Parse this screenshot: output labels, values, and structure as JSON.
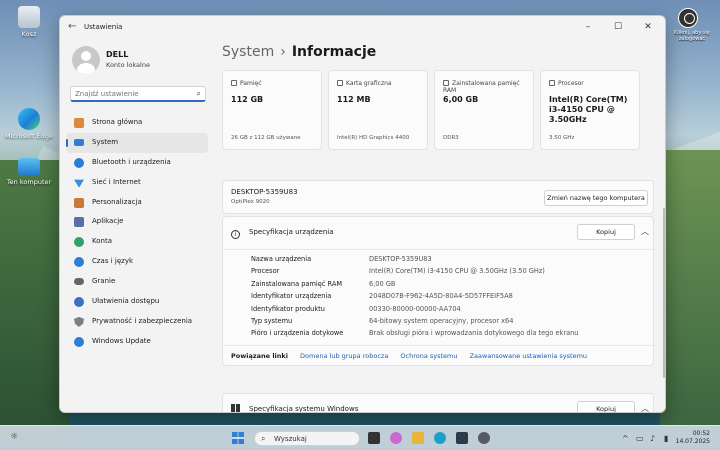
{
  "desktop": {
    "icons": [
      {
        "label": "Kosz"
      },
      {
        "label": "Microsoft Edge"
      },
      {
        "label": "Ten komputer"
      }
    ],
    "top_right_label": "Kliknij, aby się zalogować"
  },
  "window": {
    "title": "Ustawienia",
    "controls": {
      "minimize": "–",
      "maximize": "☐",
      "close": "✕"
    }
  },
  "sidebar": {
    "user_name": "DELL",
    "user_type": "Konto lokalne",
    "search_placeholder": "Znajdź ustawienie",
    "items": [
      {
        "label": "Strona główna",
        "icon": "home-icon",
        "color": "#d98a3a"
      },
      {
        "label": "System",
        "icon": "system-icon",
        "color": "#2b7fd6",
        "active": true
      },
      {
        "label": "Bluetooth i urządzenia",
        "icon": "bluetooth-icon",
        "color": "#2b7fd6"
      },
      {
        "label": "Sieć i Internet",
        "icon": "wifi-icon",
        "color": "#3a8fd9"
      },
      {
        "label": "Personalizacja",
        "icon": "brush-icon",
        "color": "#c77a3b"
      },
      {
        "label": "Aplikacje",
        "icon": "apps-icon",
        "color": "#5a6fa8"
      },
      {
        "label": "Konta",
        "icon": "account-icon",
        "color": "#2fa36b"
      },
      {
        "label": "Czas i język",
        "icon": "globe-icon",
        "color": "#2b7fd6"
      },
      {
        "label": "Granie",
        "icon": "gamepad-icon",
        "color": "#666666"
      },
      {
        "label": "Ułatwienia dostępu",
        "icon": "accessibility-icon",
        "color": "#3b6fc2"
      },
      {
        "label": "Prywatność i zabezpieczenia",
        "icon": "shield-icon",
        "color": "#7a7f87"
      },
      {
        "label": "Windows Update",
        "icon": "update-icon",
        "color": "#2b7fd6"
      }
    ]
  },
  "main": {
    "breadcrumb_parent": "System",
    "breadcrumb_sep": "›",
    "breadcrumb_current": "Informacje",
    "tiles": [
      {
        "label": "Pamięć",
        "value": "112 GB",
        "sub": "26 GB z 112 GB używane"
      },
      {
        "label": "Karta graficzna",
        "value": "112 MB",
        "sub": "Intel(R) HD Graphics 4400"
      },
      {
        "label": "Zainstalowana pamięć RAM",
        "value": "6,00 GB",
        "sub": "DDR3"
      },
      {
        "label": "Procesor",
        "value": "Intel(R) Core(TM) i3-4150 CPU @ 3.50GHz",
        "sub": "3.50 GHz"
      }
    ],
    "device": {
      "name": "DESKTOP-5359U83",
      "model": "OptiPlex 9020",
      "rename_button": "Zmień nazwę tego komputera"
    },
    "device_specs": {
      "title": "Specyfikacja urządzenia",
      "copy_button": "Kopiuj",
      "rows": [
        {
          "k": "Nazwa urządzenia",
          "v": "DESKTOP-5359U83"
        },
        {
          "k": "Procesor",
          "v": "Intel(R) Core(TM) i3-4150 CPU @ 3.50GHz (3.50 GHz)"
        },
        {
          "k": "Zainstalowana pamięć RAM",
          "v": "6,00 GB"
        },
        {
          "k": "Identyfikator urządzenia",
          "v": "2048D07B-F962-4A5D-80A4-5D57FFEIF5A8"
        },
        {
          "k": "Identyfikator produktu",
          "v": "00330-80000-00000-AA704"
        },
        {
          "k": "Typ systemu",
          "v": "64-bitowy system operacyjny, procesor x64"
        },
        {
          "k": "Pióro i urządzenia dotykowe",
          "v": "Brak obsługi pióra i wprowadzania dotykowego dla tego ekranu"
        }
      ]
    },
    "related": {
      "label": "Powiązane linki",
      "links": [
        "Domena lub grupa robocza",
        "Ochrona systemu",
        "Zaawansowane ustawienia systemu"
      ]
    },
    "windows_specs": {
      "title": "Specyfikacja systemu Windows",
      "copy_button": "Kopiuj"
    }
  },
  "taskbar": {
    "search_label": "Wyszukaj",
    "time": "00:52",
    "date": "14.07.2025",
    "apps": [
      {
        "name": "taskview",
        "color": "#333333"
      },
      {
        "name": "copilot",
        "color": "#c96ad0"
      },
      {
        "name": "explorer",
        "color": "#e8b53b"
      },
      {
        "name": "edge",
        "color": "#1aa1c9"
      },
      {
        "name": "store",
        "color": "#2d3a4a"
      },
      {
        "name": "settings",
        "color": "#555a66"
      }
    ]
  }
}
